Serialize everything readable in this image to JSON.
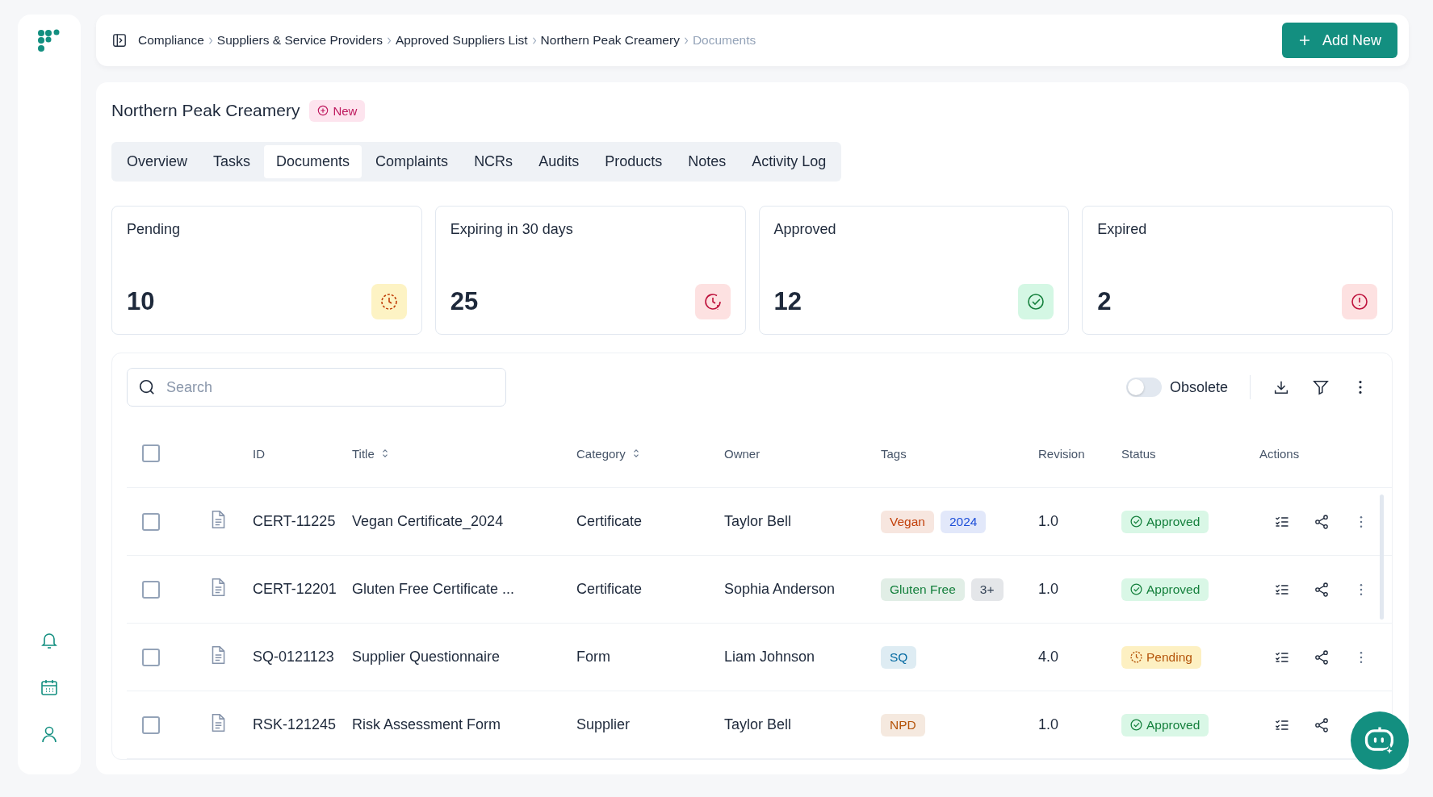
{
  "breadcrumbs": [
    {
      "label": "Compliance",
      "current": false
    },
    {
      "label": "Suppliers & Service Providers",
      "current": false
    },
    {
      "label": "Approved Suppliers List",
      "current": false
    },
    {
      "label": "Northern Peak Creamery",
      "current": false
    },
    {
      "label": "Documents",
      "current": true
    }
  ],
  "add_button": {
    "label": "Add New"
  },
  "supplier": {
    "name": "Northern Peak Creamery",
    "badge": "New"
  },
  "tabs": [
    {
      "label": "Overview",
      "selected": false
    },
    {
      "label": "Tasks",
      "selected": false
    },
    {
      "label": "Documents",
      "selected": true
    },
    {
      "label": "Complaints",
      "selected": false
    },
    {
      "label": "NCRs",
      "selected": false
    },
    {
      "label": "Audits",
      "selected": false
    },
    {
      "label": "Products",
      "selected": false
    },
    {
      "label": "Notes",
      "selected": false
    },
    {
      "label": "Activity Log",
      "selected": false
    }
  ],
  "stats": [
    {
      "label": "Pending",
      "value": "10",
      "kind": "pending"
    },
    {
      "label": "Expiring in 30 days",
      "value": "25",
      "kind": "expiring"
    },
    {
      "label": "Approved",
      "value": "12",
      "kind": "approved"
    },
    {
      "label": "Expired",
      "value": "2",
      "kind": "expired"
    }
  ],
  "search": {
    "placeholder": "Search"
  },
  "obsolete": {
    "label": "Obsolete",
    "on": false
  },
  "table": {
    "select_all": {
      "checked": false
    },
    "columns": [
      {
        "label": "ID",
        "sortable": false
      },
      {
        "label": "Title",
        "sortable": true
      },
      {
        "label": "Category",
        "sortable": true
      },
      {
        "label": "Owner",
        "sortable": false
      },
      {
        "label": "Tags",
        "sortable": false
      },
      {
        "label": "Revision",
        "sortable": false
      },
      {
        "label": "Status",
        "sortable": false
      },
      {
        "label": "Actions",
        "sortable": false
      }
    ],
    "rows": [
      {
        "checked": false,
        "id": "CERT-11225",
        "title": "Vegan Certificate_2024",
        "category": "Certificate",
        "owner": "Taylor Bell",
        "tags": [
          {
            "label": "Vegan",
            "color": "#c2410c"
          },
          {
            "label": "2024",
            "color": "#1d4ed8"
          }
        ],
        "revision": "1.0",
        "status": {
          "label": "Approved",
          "kind": "approved"
        }
      },
      {
        "checked": false,
        "id": "CERT-12201",
        "title": "Gluten Free Certificate ...",
        "category": "Certificate",
        "owner": "Sophia Anderson",
        "tags": [
          {
            "label": "Gluten Free",
            "color": "#15803d"
          },
          {
            "label": "3+",
            "color": "#334155"
          }
        ],
        "revision": "1.0",
        "status": {
          "label": "Approved",
          "kind": "approved"
        }
      },
      {
        "checked": false,
        "id": "SQ-0121123",
        "title": "Supplier Questionnaire",
        "category": "Form",
        "owner": "Liam Johnson",
        "tags": [
          {
            "label": "SQ",
            "color": "#0369a1"
          }
        ],
        "revision": "4.0",
        "status": {
          "label": "Pending",
          "kind": "pending"
        }
      },
      {
        "checked": false,
        "id": "RSK-121245",
        "title": "Risk Assessment Form",
        "category": "Supplier",
        "owner": "Taylor Bell",
        "tags": [
          {
            "label": "NPD",
            "color": "#b45309"
          }
        ],
        "revision": "1.0",
        "status": {
          "label": "Approved",
          "kind": "approved"
        }
      }
    ]
  }
}
